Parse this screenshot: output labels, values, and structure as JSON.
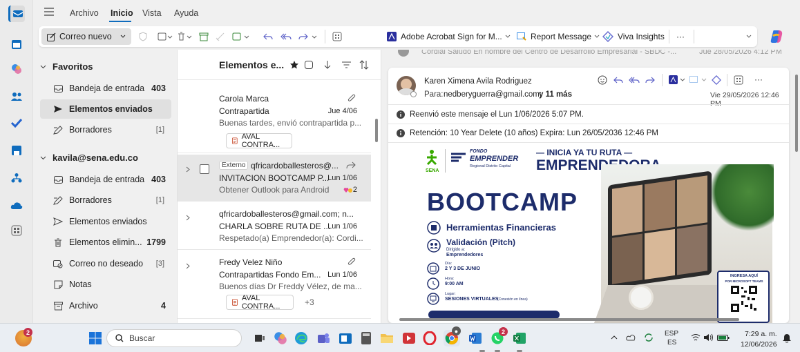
{
  "menu": {
    "tabs": [
      "Archivo",
      "Inicio",
      "Vista",
      "Ayuda"
    ],
    "active": "Inicio"
  },
  "ribbon": {
    "new_mail": "Correo nuevo",
    "adobe": "Adobe Acrobat Sign for M...",
    "report": "Report Message",
    "viva": "Viva Insights",
    "more": "···"
  },
  "folders": {
    "favorites_header": "Favoritos",
    "favorites": [
      {
        "label": "Bandeja de entrada",
        "count": "403",
        "icon": "inbox-icon"
      },
      {
        "label": "Elementos enviados",
        "count": "",
        "icon": "send-icon"
      },
      {
        "label": "Borradores",
        "count": "[1]",
        "icon": "draft-icon"
      }
    ],
    "account_header": "kavila@sena.edu.co",
    "account": [
      {
        "label": "Bandeja de entrada",
        "count": "403",
        "icon": "inbox-icon"
      },
      {
        "label": "Borradores",
        "count": "[1]",
        "icon": "draft-icon"
      },
      {
        "label": "Elementos enviados",
        "count": "",
        "icon": "send-icon"
      },
      {
        "label": "Elementos elimin...",
        "count": "1799",
        "icon": "trash-icon"
      },
      {
        "label": "Correo no deseado",
        "count": "[3]",
        "icon": "junk-icon"
      },
      {
        "label": "Notas",
        "count": "",
        "icon": "note-icon"
      },
      {
        "label": "Archivo",
        "count": "4",
        "icon": "archive-icon"
      }
    ]
  },
  "list": {
    "title": "Elementos e...",
    "items": [
      {
        "sender": "Carola Marca",
        "subject": "Contrapartida",
        "date": "Jue 4/06",
        "preview": "Buenas tardes, envió contrapartida p...",
        "attachment": "AVAL CONTRA..."
      },
      {
        "tag": "Externo",
        "sender": "qfricardoballesteros@...",
        "subject": "INVITACION BOOTCAMP P...",
        "date": "Lun 1/06",
        "preview": "Obtener Outlook para Android",
        "reaction": "2"
      },
      {
        "sender": "qfricardoballesteros@gmail.com; n...",
        "subject": "CHARLA SOBRE RUTA DE ...",
        "date": "Lun 1/06",
        "preview": "Respetado(a) Emprendedor(a): Cordi..."
      },
      {
        "sender": "Fredy Velez Niño",
        "subject": "Contrapartidas Fondo Em...",
        "date": "Lun 1/06",
        "preview": "Buenos días Dr Freddy Vélez, de ma...",
        "attachment": "AVAL CONTRA...",
        "extra": "+3"
      }
    ]
  },
  "reading": {
    "top_partial": "Cordial Saludo En nombre del Centro de Desarrollo Empresarial - SBDC -...",
    "top_partial_date": "Jue 28/05/2026 4:12 PM",
    "sender": "Karen Ximena Avila Rodriguez",
    "to_label": "Para:",
    "to": "nedberyguerra@gmail.com;",
    "more": "y 11 más",
    "date": "Vie 29/05/2026 12:46 PM",
    "info1": "Reenvió este mensaje el Lun 1/06/2026 5:07 PM.",
    "info2": "Retención: 10 Year Delete (10 años) Expira: Lun 26/05/2036 12:46 PM"
  },
  "flyer": {
    "logo_text": "SENA",
    "fondo": "FONDO",
    "emprender": "EMPRENDER",
    "regional": "Regional Distrito Capital",
    "tag1": "— INICIA YA TU RUTA —",
    "tag2": "EMPRENDEDORA",
    "title": "BOOTCAMP",
    "item1": "Herramientas Financieras",
    "item2": "Validación (Pitch)",
    "dirigido": "Dirigido a:",
    "emprendedores": "Emprendedores",
    "dia_label": "Día:",
    "dia": "2 Y 3 DE JUNIO",
    "hora_label": "Hora:",
    "hora": "9:00 AM",
    "lugar_label": "Lugar:",
    "lugar": "SESIONES VIRTUALES",
    "lugar_note": "(Conexión en línea)",
    "ingresa1": "INGRESA AQUÍ",
    "ingresa2": "POR MICROSOFT TEAMS"
  },
  "taskbar": {
    "search": "Buscar",
    "lang1": "ESP",
    "lang2": "ES",
    "time": "7:29 a. m.",
    "date": "12/06/2026",
    "badge_left": "2",
    "badge_wa": "2"
  },
  "colors": {
    "accent": "#0f6cbd",
    "sena_green": "#39a900",
    "navy": "#1d2c6b"
  }
}
